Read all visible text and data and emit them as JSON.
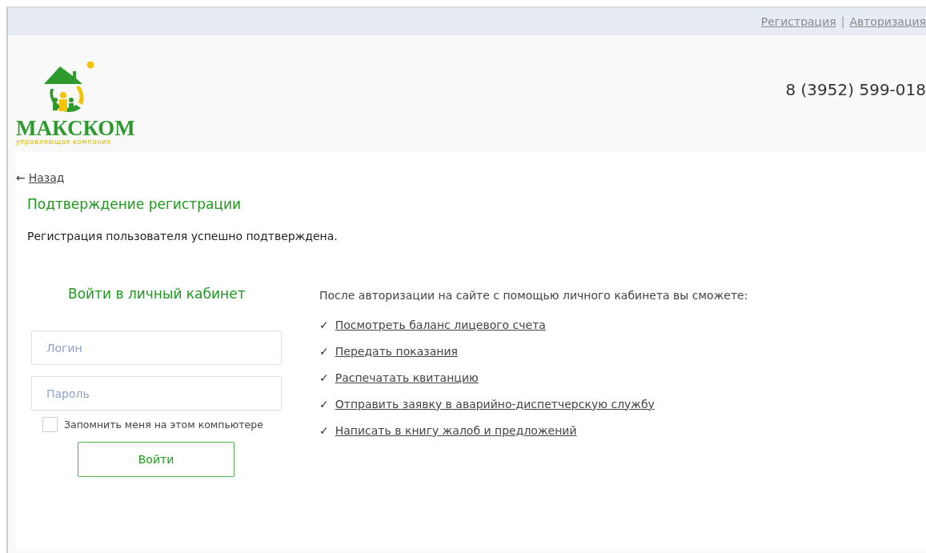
{
  "top_links": [
    {
      "label": "Регистрация"
    },
    {
      "label": "Авторизация"
    }
  ],
  "top_separator": "|",
  "logo": {
    "name": "МАКСКОМ",
    "tagline": "управляющая компания"
  },
  "phone": "8 (3952) 599-018",
  "back_link": {
    "arrow": "←",
    "label": "Назад"
  },
  "page_title": "Подтверждение регистрации",
  "message": "Регистрация пользователя успешно подтверждена.",
  "login": {
    "title": "Войти в личный кабинет",
    "login_placeholder": "Логин",
    "password_placeholder": "Пароль",
    "remember": {
      "label": "Запомнить меня на этом компьютере",
      "checked": false
    },
    "button": "Войти"
  },
  "features": {
    "intro": "После авторизации на сайте с помощью личного кабинета вы сможете:",
    "items": [
      {
        "mark": "✓",
        "label": "Посмотреть баланс лицевого счета"
      },
      {
        "mark": "✓",
        "label": "Передать показания"
      },
      {
        "mark": "✓",
        "label": "Распечатать квитанцию"
      },
      {
        "mark": "✓",
        "label": "Отправить заявку в аварийно-диспетчерскую службу"
      },
      {
        "mark": "✓",
        "label": "Написать в книгу жалоб и предложений"
      }
    ]
  }
}
